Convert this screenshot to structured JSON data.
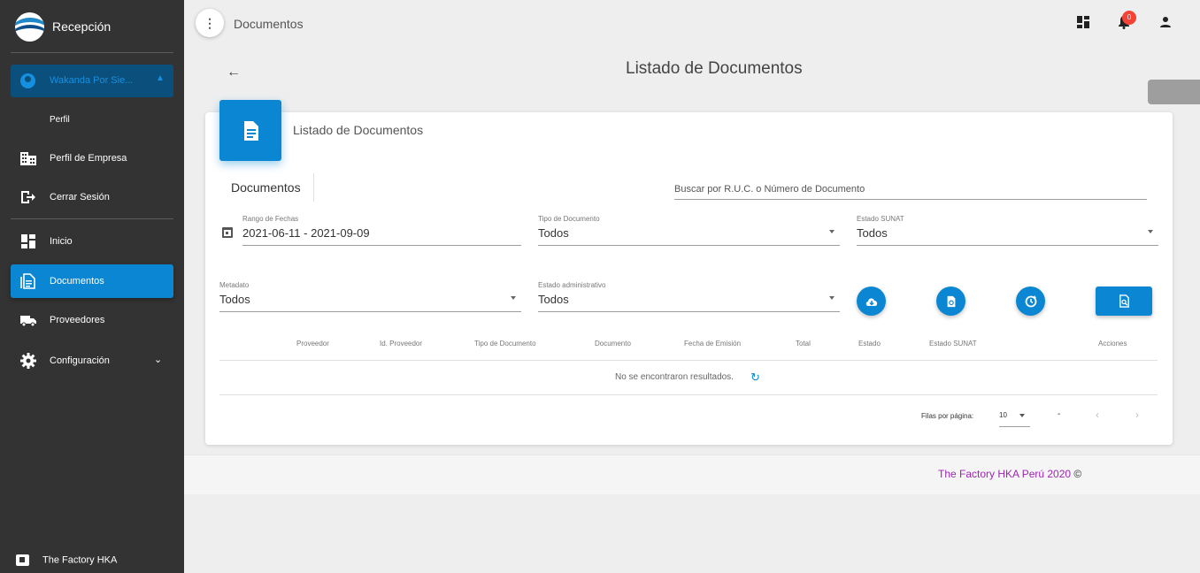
{
  "sidebar": {
    "brand_title": "Recepción",
    "user_name": "Wakanda Por Sie...",
    "profile_label": "Perfil",
    "items": [
      {
        "label": "Perfil de Empresa"
      },
      {
        "label": "Cerrar Sesión"
      },
      {
        "label": "Inicio"
      },
      {
        "label": "Documentos"
      },
      {
        "label": "Proveedores"
      },
      {
        "label": "Configuración"
      }
    ],
    "footer_label": "The Factory HKA"
  },
  "topbar": {
    "title": "Documentos",
    "notification_count": "0"
  },
  "page": {
    "title": "Listado de Documentos"
  },
  "card": {
    "title": "Listado de Documentos",
    "tab_label": "Documentos",
    "search_placeholder": "Buscar por R.U.C. o Número de Documento"
  },
  "filters": {
    "date_range": {
      "label": "Rango de Fechas",
      "value": "2021-06-11 - 2021-09-09"
    },
    "doc_type": {
      "label": "Tipo de Documento",
      "value": "Todos"
    },
    "sunat_status": {
      "label": "Estado SUNAT",
      "value": "Todos"
    },
    "metadata": {
      "label": "Metadato",
      "value": "Todos"
    },
    "admin_status": {
      "label": "Estado administrativo",
      "value": "Todos"
    }
  },
  "table": {
    "headers": [
      "Proveedor",
      "Id. Proveedor",
      "Tipo de Documento",
      "Documento",
      "Fecha de Emisión",
      "Total",
      "Estado",
      "Estado SUNAT",
      "Acciones"
    ],
    "empty_message": "No se encontraron resultados."
  },
  "pagination": {
    "rows_label": "Filas por página:",
    "rows_value": "10",
    "range_text": "-"
  },
  "footer": {
    "text": "The Factory HKA Perú 2020",
    "symbol": "©"
  },
  "colors": {
    "primary": "#0b86d2",
    "sidebar_bg": "#333333",
    "footer_text": "#9c27b0",
    "badge": "#f44336"
  }
}
